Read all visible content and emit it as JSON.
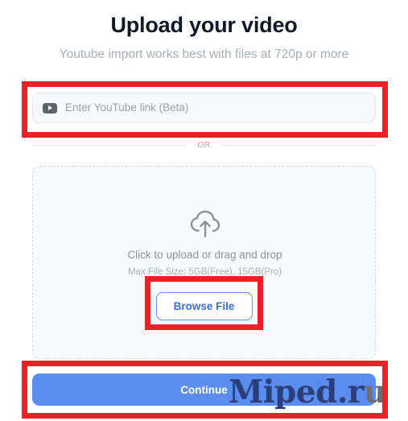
{
  "page": {
    "title": "Upload your video",
    "subtitle": "Youtube import works best with files at 720p or more"
  },
  "youtube_input": {
    "icon": "youtube-play-icon",
    "placeholder": "Enter YouTube link (Beta)",
    "value": ""
  },
  "divider": {
    "label": "OR"
  },
  "dropzone": {
    "icon": "cloud-upload-icon",
    "primary_text": "Click to upload or drag and drop",
    "secondary_text": "Max File Size: 5GB(Free), 15GB(Pro)",
    "browse_label": "Browse File"
  },
  "footer": {
    "continue_label": "Continue"
  },
  "watermark": {
    "text_main": "Miped.r",
    "text_tail": "u"
  },
  "annotations": {
    "boxes": [
      {
        "name": "youtube-input-highlight"
      },
      {
        "name": "browse-file-highlight"
      },
      {
        "name": "continue-highlight"
      }
    ],
    "color": "#ec2027"
  },
  "colors": {
    "accent_blue": "#5b8cf0",
    "browse_blue": "#3b6fe0",
    "title": "#111827",
    "muted": "#a9aeb8",
    "dropzone_bg": "#f8f9fb",
    "input_bg": "#f7f8fa",
    "annotation_red": "#ec2027",
    "watermark_navy": "#2b3f7a"
  }
}
